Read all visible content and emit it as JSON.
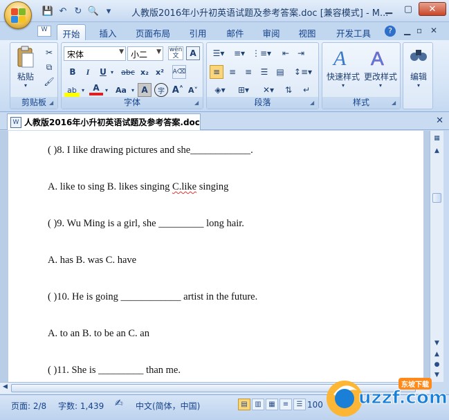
{
  "window": {
    "title": "人教版2016年小升初英语试题及参考答案.doc [兼容模式] - M...",
    "controls": [
      "minimize",
      "maximize",
      "close"
    ]
  },
  "quick_access": [
    "save-icon",
    "undo-icon",
    "redo-icon",
    "print-preview-icon",
    "customize-icon"
  ],
  "tabs": [
    {
      "label": "开始",
      "active": true
    },
    {
      "label": "插入"
    },
    {
      "label": "页面布局"
    },
    {
      "label": "引用"
    },
    {
      "label": "邮件"
    },
    {
      "label": "审阅"
    },
    {
      "label": "视图"
    },
    {
      "label": "开发工具"
    }
  ],
  "ribbon": {
    "clipboard": {
      "label": "剪贴板",
      "paste": "粘贴"
    },
    "font": {
      "label": "字体",
      "name": "宋体",
      "size": "小二",
      "wen": "wén",
      "A": "A"
    },
    "paragraph": {
      "label": "段落"
    },
    "styles": {
      "label": "样式",
      "quick": "快速样式",
      "change": "更改样式"
    },
    "editing": {
      "edit": "编辑"
    }
  },
  "document_tab": {
    "label": "人教版2016年小升初英语试题及参考答案.doc"
  },
  "document": {
    "lines": [
      "( )8.  I like  drawing pictures and she____________.",
      "A. like to sing  B. likes  singing  ",
      "C.like",
      " singing",
      "( )9.  Wu Ming is a girl, she _________ long hair.",
      "A. has B. was C. have",
      "( )10.  He is  going  ____________  artist in the future.",
      "A. to an B. to be an C. an",
      "( )11.  She is _________ than me."
    ]
  },
  "status_bar": {
    "page": "页面: 2/8",
    "words": "字数: 1,439",
    "language": "中文(简体，中国)",
    "zoom": "100"
  },
  "watermark": {
    "brand": "uzzf.com",
    "tag": "东坡下载"
  },
  "colors": {
    "accent": "#15428b",
    "ribbon": "#dce8f7",
    "highlight": "#fbd57a"
  }
}
